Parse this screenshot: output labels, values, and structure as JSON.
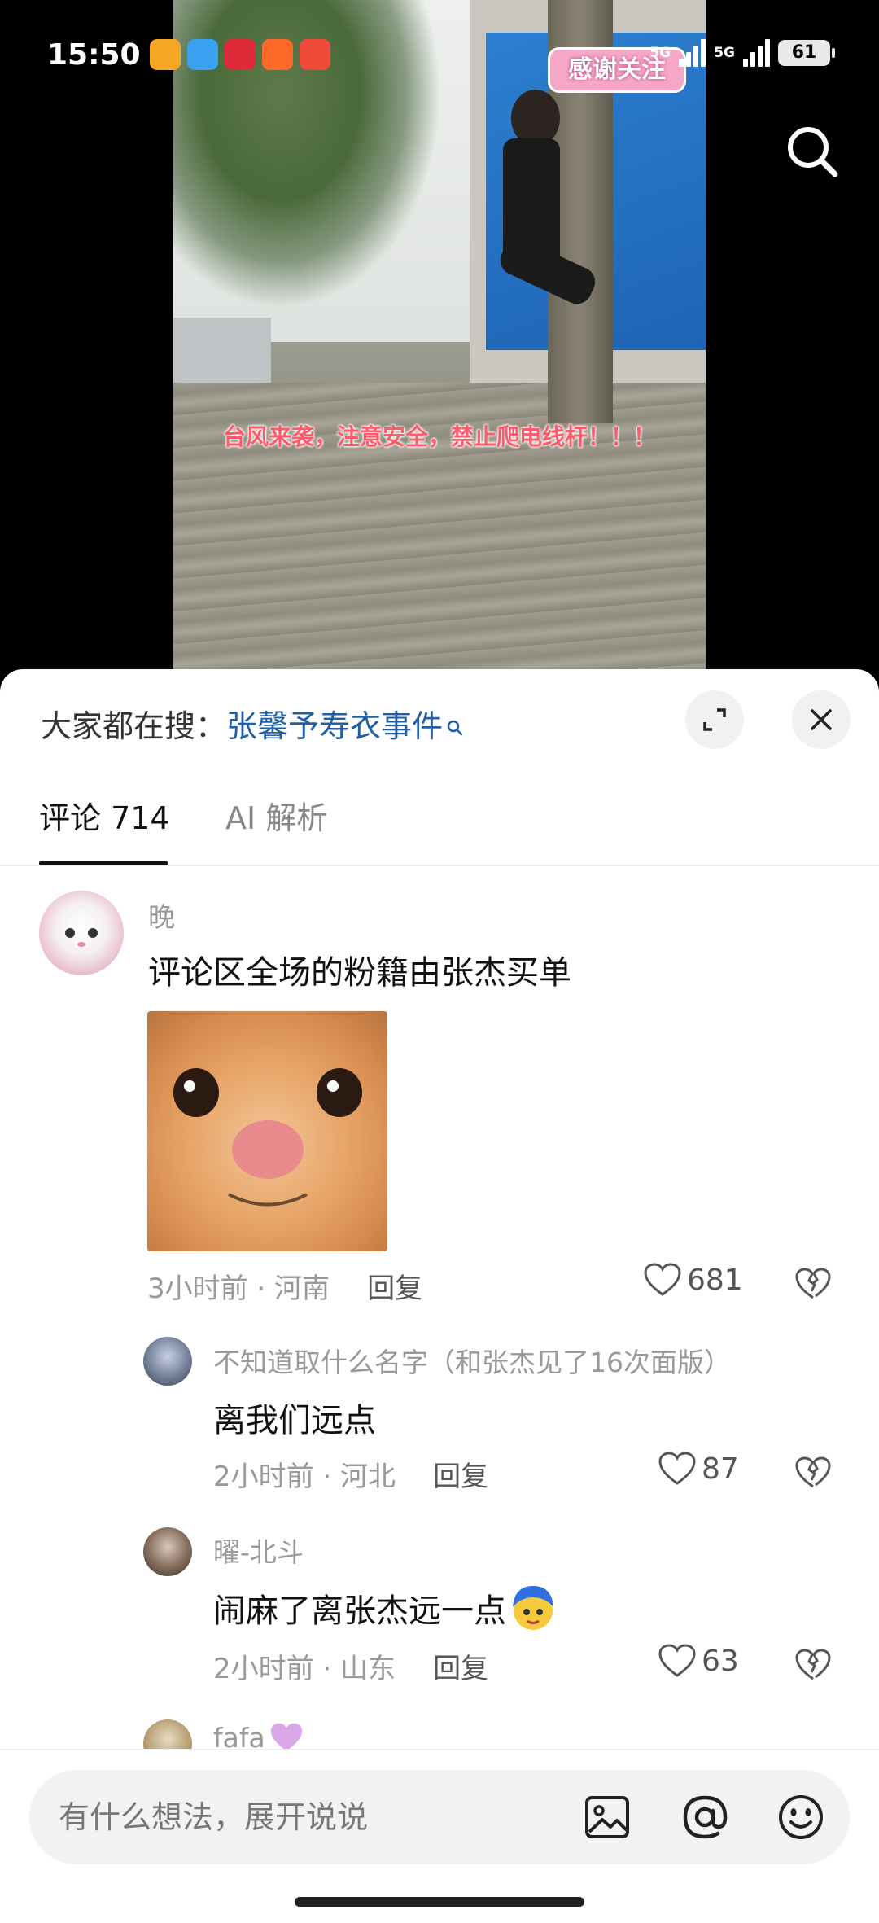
{
  "status_bar": {
    "time": "15:50",
    "network_1": "5G",
    "network_2": "5G",
    "battery": "61"
  },
  "video": {
    "caption": "台风来袭，注意安全，禁止爬电线杆！！！",
    "sticker": "感谢关注"
  },
  "search": {
    "icon": "search-icon"
  },
  "panel": {
    "trending_label": "大家都在搜：",
    "trending_keyword": "张馨予寿衣事件",
    "tabs": [
      {
        "label": "评论 714",
        "active": true
      },
      {
        "label": "AI 解析",
        "active": false
      }
    ]
  },
  "comments": [
    {
      "username": "晚",
      "text": "评论区全场的粉籍由张杰买单",
      "time_location": "3小时前 · 河南",
      "reply_label": "回复",
      "likes": "681",
      "has_image": true
    },
    {
      "username": "不知道取什么名字（和张杰见了16次面版）",
      "text": "离我们远点",
      "time_location": "2小时前 · 河北",
      "reply_label": "回复",
      "likes": "87"
    },
    {
      "username": "曜-北斗",
      "text": "闹麻了离张杰远一点",
      "time_location": "2小时前 · 山东",
      "reply_label": "回复",
      "likes": "63"
    },
    {
      "username": "fafa"
    }
  ],
  "input_bar": {
    "placeholder": "有什么想法，展开说说"
  },
  "colors": {
    "accent_keyword": "#1f5fa8",
    "muted_text": "#999999",
    "panel_bg": "#ffffff"
  }
}
